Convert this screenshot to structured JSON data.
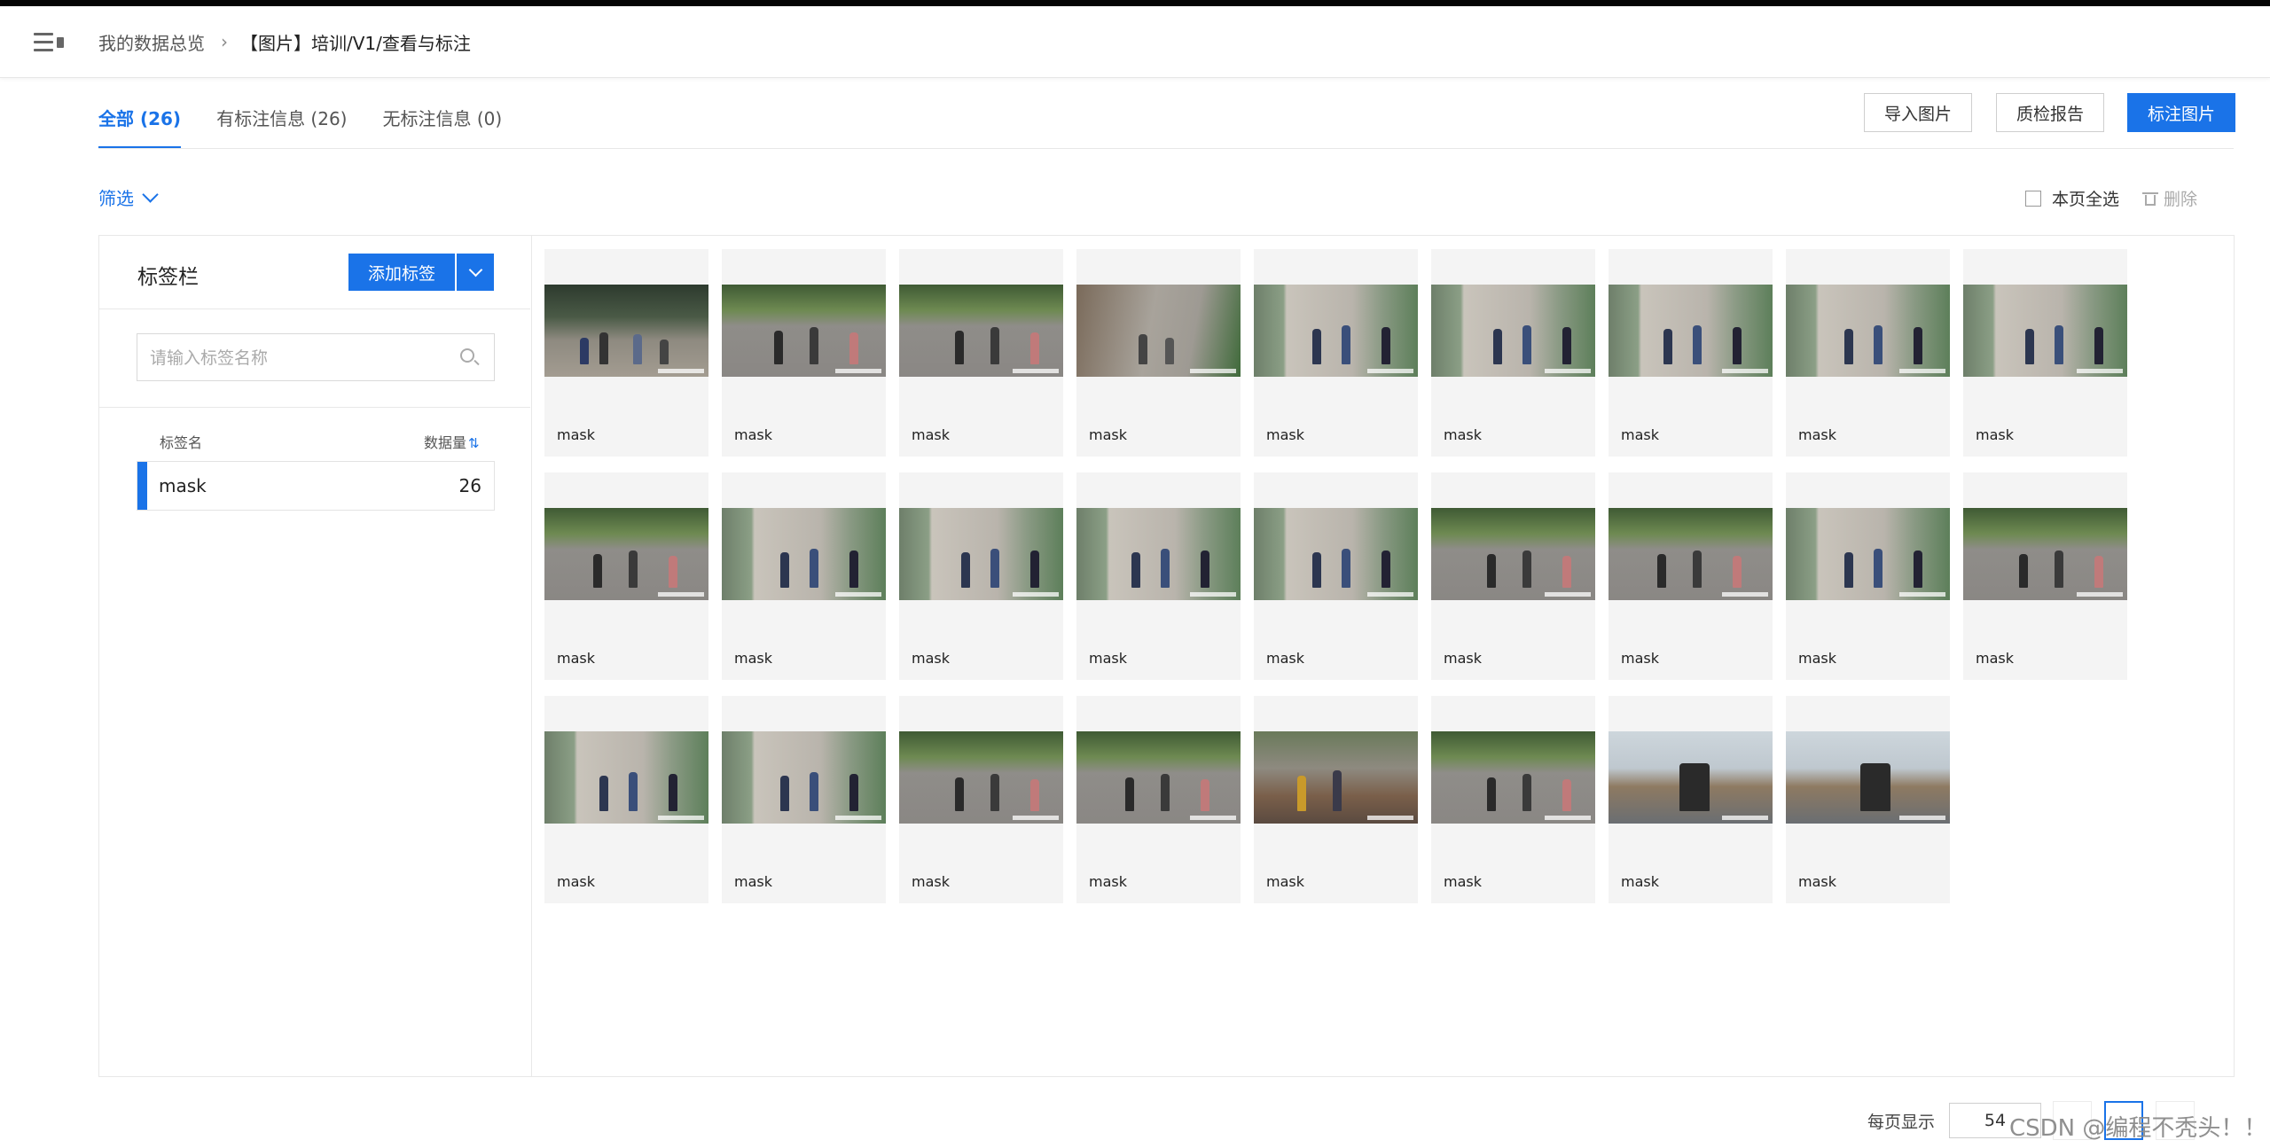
{
  "header": {
    "breadcrumb_root": "我的数据总览",
    "breadcrumb_current": "【图片】培训/V1/查看与标注"
  },
  "tabs": [
    {
      "label": "全部 (26)",
      "active": true
    },
    {
      "label": "有标注信息 (26)",
      "active": false
    },
    {
      "label": "无标注信息 (0)",
      "active": false
    }
  ],
  "toolbar": {
    "import_label": "导入图片",
    "report_label": "质检报告",
    "annotate_label": "标注图片"
  },
  "filter": {
    "label": "筛选"
  },
  "selection": {
    "select_all_label": "本页全选",
    "delete_label": "删除"
  },
  "sidebar": {
    "title": "标签栏",
    "add_label": "添加标签",
    "search_placeholder": "请输入标签名称",
    "col_name": "标签名",
    "col_count": "数据量",
    "labels": [
      {
        "name": "mask",
        "count": "26"
      }
    ]
  },
  "images": [
    {
      "label": "mask",
      "scene": "plaza"
    },
    {
      "label": "mask",
      "scene": "walkway"
    },
    {
      "label": "mask",
      "scene": "walkway"
    },
    {
      "label": "mask",
      "scene": "rail"
    },
    {
      "label": "mask",
      "scene": "gate"
    },
    {
      "label": "mask",
      "scene": "gate"
    },
    {
      "label": "mask",
      "scene": "gate"
    },
    {
      "label": "mask",
      "scene": "gate"
    },
    {
      "label": "mask",
      "scene": "gate"
    },
    {
      "label": "mask",
      "scene": "walkway"
    },
    {
      "label": "mask",
      "scene": "gate"
    },
    {
      "label": "mask",
      "scene": "gate"
    },
    {
      "label": "mask",
      "scene": "gate"
    },
    {
      "label": "mask",
      "scene": "gate"
    },
    {
      "label": "mask",
      "scene": "walkway"
    },
    {
      "label": "mask",
      "scene": "walkway"
    },
    {
      "label": "mask",
      "scene": "gate"
    },
    {
      "label": "mask",
      "scene": "walkway"
    },
    {
      "label": "mask",
      "scene": "gate"
    },
    {
      "label": "mask",
      "scene": "gate"
    },
    {
      "label": "mask",
      "scene": "walkway"
    },
    {
      "label": "mask",
      "scene": "walkway"
    },
    {
      "label": "mask",
      "scene": "stairs"
    },
    {
      "label": "mask",
      "scene": "walkway"
    },
    {
      "label": "mask",
      "scene": "office"
    },
    {
      "label": "mask",
      "scene": "office"
    }
  ],
  "pagination": {
    "per_page_label": "每页显示",
    "per_page": "54",
    "current_page": "1"
  },
  "watermark": "CSDN @编程不秃头！！",
  "colors": {
    "accent": "#1a73e8",
    "card_bg": "#f4f4f4",
    "border": "#e8e8e8"
  }
}
